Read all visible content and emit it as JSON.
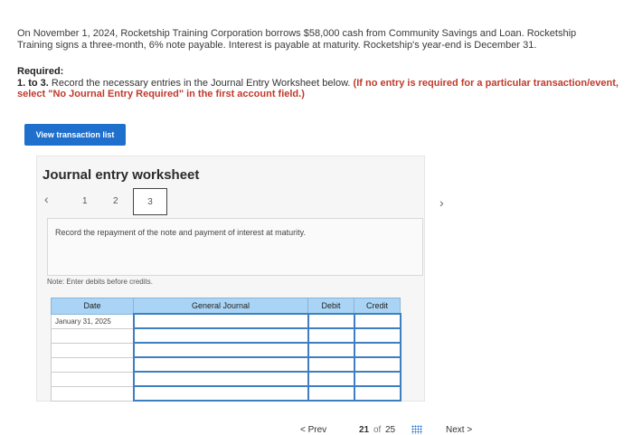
{
  "intro": {
    "line1": "On November 1, 2024, Rocketship Training Corporation borrows $58,000 cash from Community Savings and Loan. Rocketship",
    "line2": "Training signs a three-month, 6% note payable. Interest is payable at maturity. Rocketship's year-end is December 31."
  },
  "required": {
    "title": "Required:",
    "steps": "1. to 3.",
    "instruction": " Record the necessary entries in the Journal Entry Worksheet below. ",
    "note": "(If no entry is required for a particular transaction/event, select \"No Journal Entry Required\" in the first account field.)"
  },
  "buttons": {
    "view_transactions": "View transaction list"
  },
  "worksheet": {
    "title": "Journal entry worksheet",
    "steps": [
      "1",
      "2",
      "3"
    ],
    "prev_icon": "‹",
    "next_icon": "›",
    "prompt": "Record the repayment of the note and payment of interest at maturity.",
    "note": "Note: Enter debits before credits."
  },
  "table": {
    "headers": [
      "Date",
      "General Journal",
      "Debit",
      "Credit"
    ],
    "first_date": "January 31, 2025"
  },
  "pagination": {
    "prev": "< Prev",
    "current": "21",
    "of": "of",
    "total": "25",
    "next": "Next >"
  },
  "colors": {
    "accent": "#1f6fcc",
    "header_blue": "#a9d4f5",
    "red_note": "#c0392b"
  }
}
